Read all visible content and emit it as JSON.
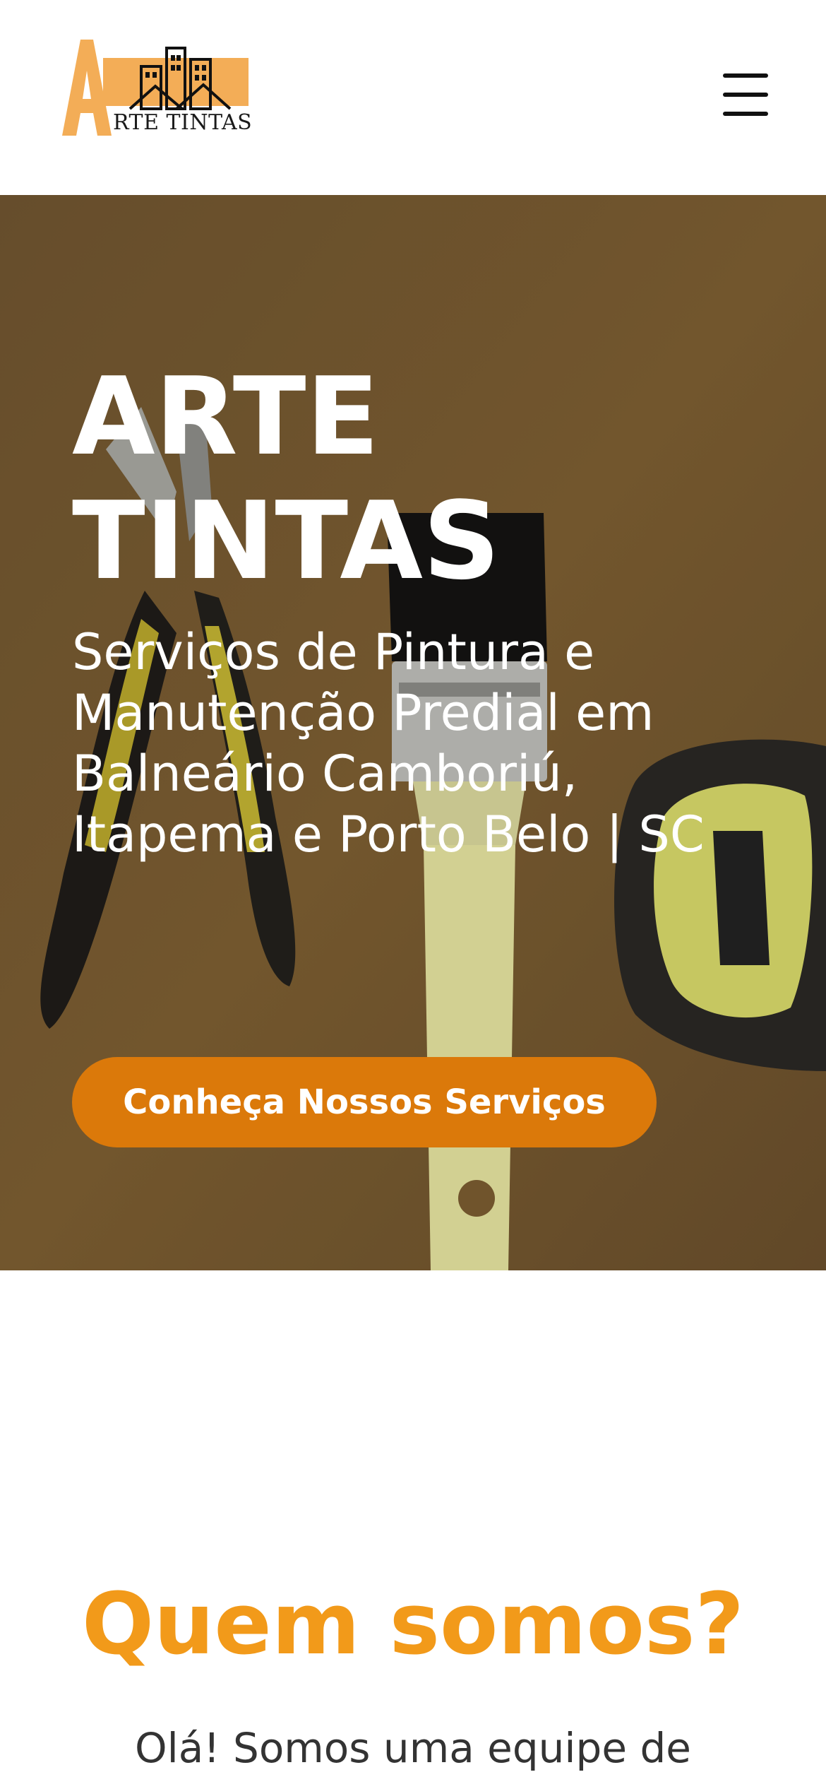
{
  "header": {
    "logo": {
      "letter": "A",
      "word": "RTE TINTAS"
    },
    "menu_icon": "hamburger-menu-icon"
  },
  "hero": {
    "title_line1": "ARTE",
    "title_line2": "TINTAS",
    "subtitle_lines": [
      "Serviços de Pintura e",
      "Manutenção Predial em",
      "Balneário Camboriú,",
      "Itapema e Porto Belo | SC"
    ],
    "cta_label": "Conheça Nossos Serviços",
    "background_image": "tools-on-ochre-background",
    "colors": {
      "cta": "#db790a",
      "overlay": "#7a5c30"
    }
  },
  "about": {
    "title": "Quem somos?",
    "text": "Olá! Somos uma equipe de",
    "title_color": "#f29a1a"
  }
}
